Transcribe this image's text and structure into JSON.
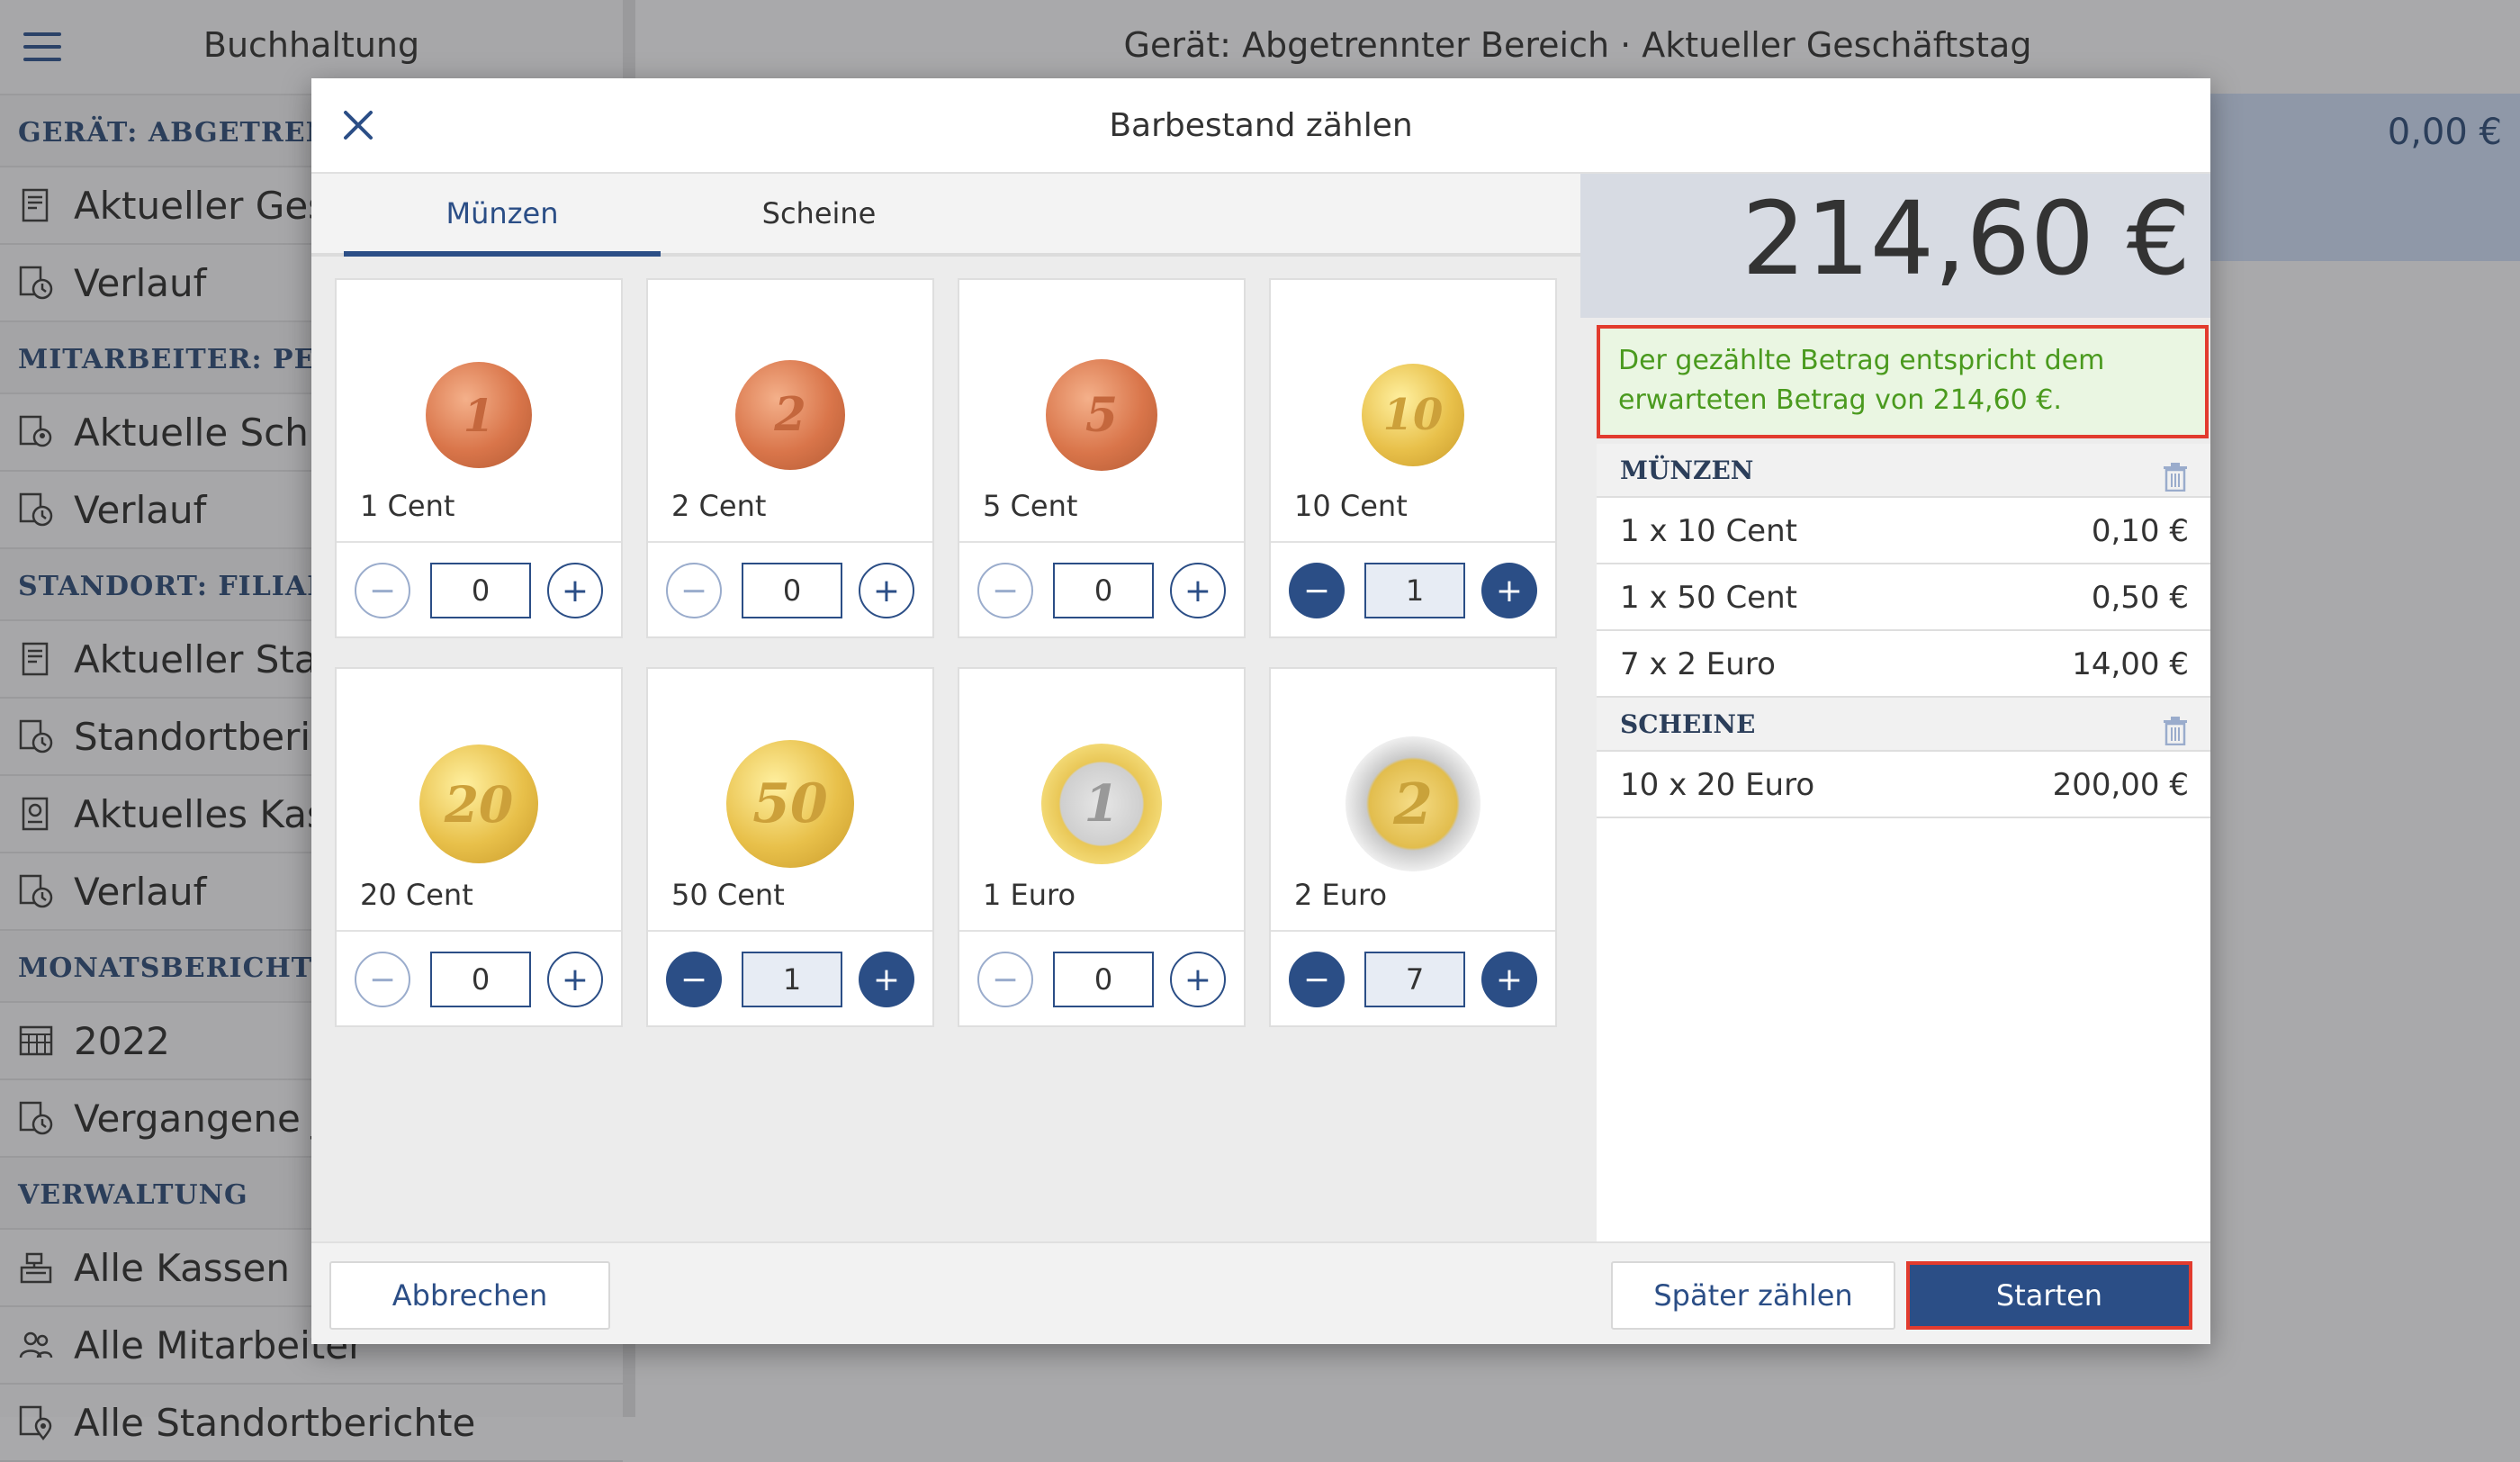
{
  "app": {
    "sidebar_title": "Buchhaltung",
    "main_title": "Gerät: Abgetrennter Bereich · Aktueller Geschäftstag",
    "main_amount": "0,00 €"
  },
  "sidebar": {
    "sections": [
      {
        "title": "GERÄT: ABGETRENNTER BEREICH",
        "items": [
          {
            "label": "Aktueller Geschäftstag",
            "icon": "receipt-icon"
          },
          {
            "label": "Verlauf",
            "icon": "history-icon"
          }
        ]
      },
      {
        "title": "MITARBEITER: PETER H",
        "items": [
          {
            "label": "Aktuelle Schicht",
            "icon": "shift-icon"
          },
          {
            "label": "Verlauf",
            "icon": "history-icon"
          }
        ]
      },
      {
        "title": "STANDORT: FILIALE AM",
        "items": [
          {
            "label": "Aktueller Standort",
            "icon": "receipt-icon"
          },
          {
            "label": "Standortbericht",
            "icon": "history-icon"
          },
          {
            "label": "Aktuelles Kassenbuch",
            "icon": "cashbook-icon"
          },
          {
            "label": "Verlauf",
            "icon": "history-icon"
          }
        ]
      },
      {
        "title": "MONATSBERICHTE",
        "items": [
          {
            "label": "2022",
            "icon": "calendar-icon"
          },
          {
            "label": "Vergangene Jahre",
            "icon": "history-icon"
          }
        ]
      },
      {
        "title": "VERWALTUNG",
        "items": [
          {
            "label": "Alle Kassen",
            "icon": "register-icon"
          },
          {
            "label": "Alle Mitarbeiter",
            "icon": "people-icon"
          },
          {
            "label": "Alle Standortberichte",
            "icon": "location-icon"
          }
        ]
      }
    ]
  },
  "modal": {
    "title": "Barbestand zählen",
    "tabs": [
      {
        "label": "Münzen",
        "active": true
      },
      {
        "label": "Scheine",
        "active": false
      }
    ],
    "coins": [
      {
        "label": "1 Cent",
        "count": "0",
        "mark": "1",
        "kind": "copper"
      },
      {
        "label": "2 Cent",
        "count": "0",
        "mark": "2",
        "kind": "copper"
      },
      {
        "label": "5 Cent",
        "count": "0",
        "mark": "5",
        "kind": "copper"
      },
      {
        "label": "10 Cent",
        "count": "1",
        "mark": "10",
        "kind": "gold"
      },
      {
        "label": "20 Cent",
        "count": "0",
        "mark": "20",
        "kind": "gold"
      },
      {
        "label": "50 Cent",
        "count": "1",
        "mark": "50",
        "kind": "gold"
      },
      {
        "label": "1 Euro",
        "count": "0",
        "mark": "1",
        "kind": "euro1"
      },
      {
        "label": "2 Euro",
        "count": "7",
        "mark": "2",
        "kind": "euro2"
      }
    ],
    "total": "214,60 €",
    "message": "Der gezählte Betrag entspricht dem erwarteten Betrag von 214,60 €.",
    "summary": {
      "coins_title": "MÜNZEN",
      "coins": [
        {
          "label": "1 x 10 Cent",
          "value": "0,10 €"
        },
        {
          "label": "1 x 50 Cent",
          "value": "0,50 €"
        },
        {
          "label": "7 x 2 Euro",
          "value": "14,00 €"
        }
      ],
      "notes_title": "SCHEINE",
      "notes": [
        {
          "label": "10 x 20 Euro",
          "value": "200,00 €"
        }
      ]
    },
    "buttons": {
      "cancel": "Abbrechen",
      "later": "Später zählen",
      "start": "Starten"
    }
  },
  "colors": {
    "accent": "#2b4e86",
    "highlight": "#e23b2e",
    "success_text": "#4a9a1e"
  }
}
